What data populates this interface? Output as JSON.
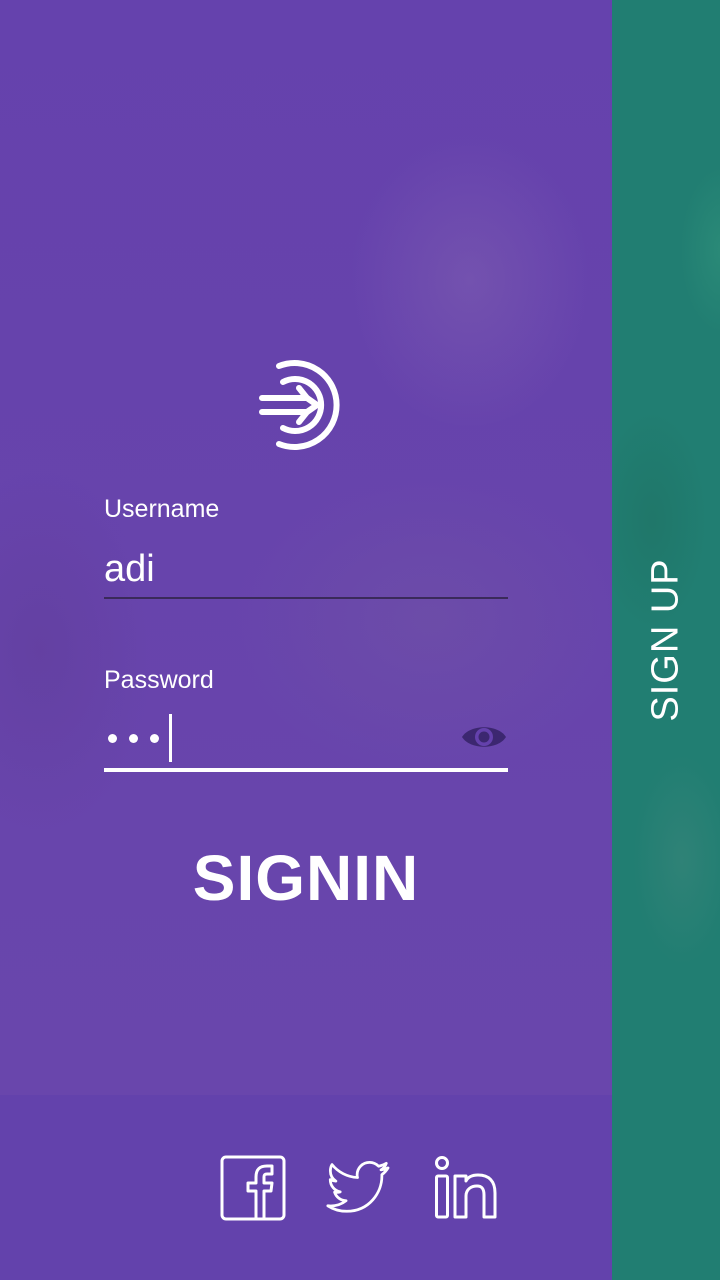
{
  "login": {
    "username_label": "Username",
    "username_value": "adi",
    "password_label": "Password",
    "password_dot_count": 3,
    "signin_label": "SIGNIN"
  },
  "signup": {
    "label": "SIGN UP"
  },
  "social": {
    "icons": [
      "facebook-icon",
      "twitter-icon",
      "linkedin-icon"
    ]
  },
  "colors": {
    "primary_purple": "#6441ac",
    "signup_teal": "#217e72",
    "text": "#ffffff"
  }
}
